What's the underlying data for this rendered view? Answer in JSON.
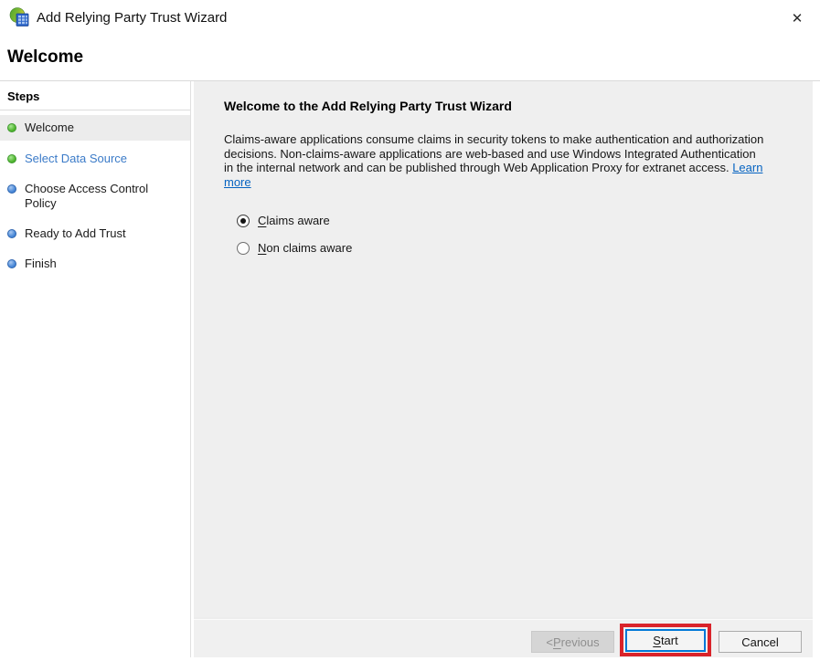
{
  "window": {
    "title": "Add Relying Party Trust Wizard",
    "close_glyph": "✕"
  },
  "page": {
    "heading": "Welcome"
  },
  "steps": {
    "header": "Steps",
    "items": [
      {
        "label": "Welcome",
        "bullet": "green",
        "state": "current"
      },
      {
        "label": "Select Data Source",
        "bullet": "green",
        "state": "link"
      },
      {
        "label": "Choose Access Control Policy",
        "bullet": "blue",
        "state": "pending"
      },
      {
        "label": "Ready to Add Trust",
        "bullet": "blue",
        "state": "pending"
      },
      {
        "label": "Finish",
        "bullet": "blue",
        "state": "pending"
      }
    ]
  },
  "content": {
    "heading": "Welcome to the Add Relying Party Trust Wizard",
    "body_text": "Claims-aware applications consume claims in security tokens to make authentication and authorization decisions. Non-claims-aware applications are web-based and use Windows Integrated Authentication in the internal network and can be published through Web Application Proxy for extranet access. ",
    "learn_more_label": "Learn more",
    "radios": [
      {
        "accel": "C",
        "rest": "laims aware",
        "selected": true
      },
      {
        "accel": "N",
        "rest": "on claims aware",
        "selected": false
      }
    ]
  },
  "footer": {
    "previous": {
      "prefix": "< ",
      "accel": "P",
      "rest": "revious"
    },
    "start": {
      "accel": "S",
      "rest": "tart"
    },
    "cancel_label": "Cancel"
  },
  "colors": {
    "bullet_green": "#4db32c",
    "bullet_blue": "#4585d6",
    "step_link": "#3b7bc8",
    "link": "#0563c1",
    "focus_blue": "#0078d7",
    "annotation_red": "#d9232a",
    "content_bg": "#efefef",
    "footer_bg": "#f0f0f0",
    "highlight_row": "#ececec"
  }
}
